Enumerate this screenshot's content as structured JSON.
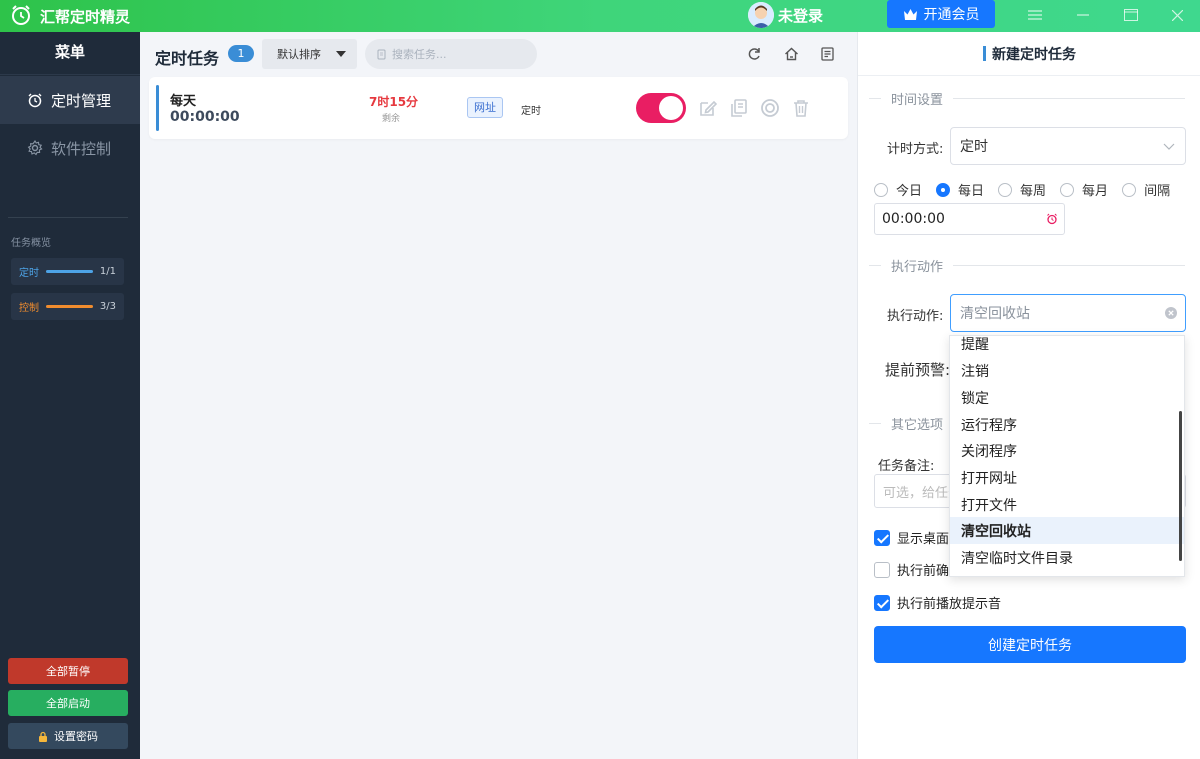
{
  "app": {
    "title": "汇帮定时精灵"
  },
  "header": {
    "user_label": "未登录",
    "vip_label": "开通会员"
  },
  "sidebar": {
    "menu_title": "菜单",
    "items": [
      {
        "label": "定时管理",
        "icon": "alarm-clock-icon"
      },
      {
        "label": "软件控制",
        "icon": "gear-icon"
      }
    ],
    "overview_label": "任务概览",
    "overview": [
      {
        "label": "定时",
        "count": "1/1",
        "color": "#4da3e6",
        "fill": 1.0
      },
      {
        "label": "控制",
        "count": "3/3",
        "color": "#f08c2e",
        "fill": 1.0
      }
    ],
    "buttons": {
      "pause_all": "全部暂停",
      "start_all": "全部启动",
      "set_password": "设置密码"
    },
    "button_colors": {
      "pause": "#c0392b",
      "start": "#27ae60",
      "password": "#34495e"
    }
  },
  "main": {
    "title": "定时任务",
    "count": "1",
    "sort_label": "默认排序",
    "search_placeholder": "搜索任务...",
    "tasks": [
      {
        "frequency": "每天",
        "time": "00:00:00",
        "remaining": "7时15分",
        "remaining_label": "剩余",
        "tag": "网址",
        "type": "定时",
        "enabled": true
      }
    ]
  },
  "panel": {
    "title": "新建定时任务",
    "time_section": "时间设置",
    "timing_label": "计时方式:",
    "timing_value": "定时",
    "modes": [
      "今日",
      "每日",
      "每周",
      "每月",
      "间隔"
    ],
    "mode_selected": "每日",
    "time_value": "00:00:00",
    "action_section": "执行动作",
    "action_label": "执行动作:",
    "action_value": "清空回收站",
    "warn_label": "提前预警:",
    "other_section": "其它选项",
    "note_label": "任务备注:",
    "note_placeholder": "可选，给任务",
    "checkboxes": [
      {
        "label": "显示桌面",
        "checked": true
      },
      {
        "label": "执行前确",
        "checked": false
      },
      {
        "label": "执行前播放提示音",
        "checked": true
      }
    ],
    "create_button": "创建定时任务"
  },
  "dropdown": {
    "options": [
      "提醒",
      "注销",
      "锁定",
      "运行程序",
      "关闭程序",
      "打开网址",
      "打开文件",
      "清空回收站",
      "清空临时文件目录"
    ],
    "selected": "清空回收站"
  },
  "colors": {
    "accent": "#1677ff",
    "toggle_on": "#e91e63",
    "remaining": "#e6393f",
    "sidebar_bg": "#1f2b3a"
  }
}
